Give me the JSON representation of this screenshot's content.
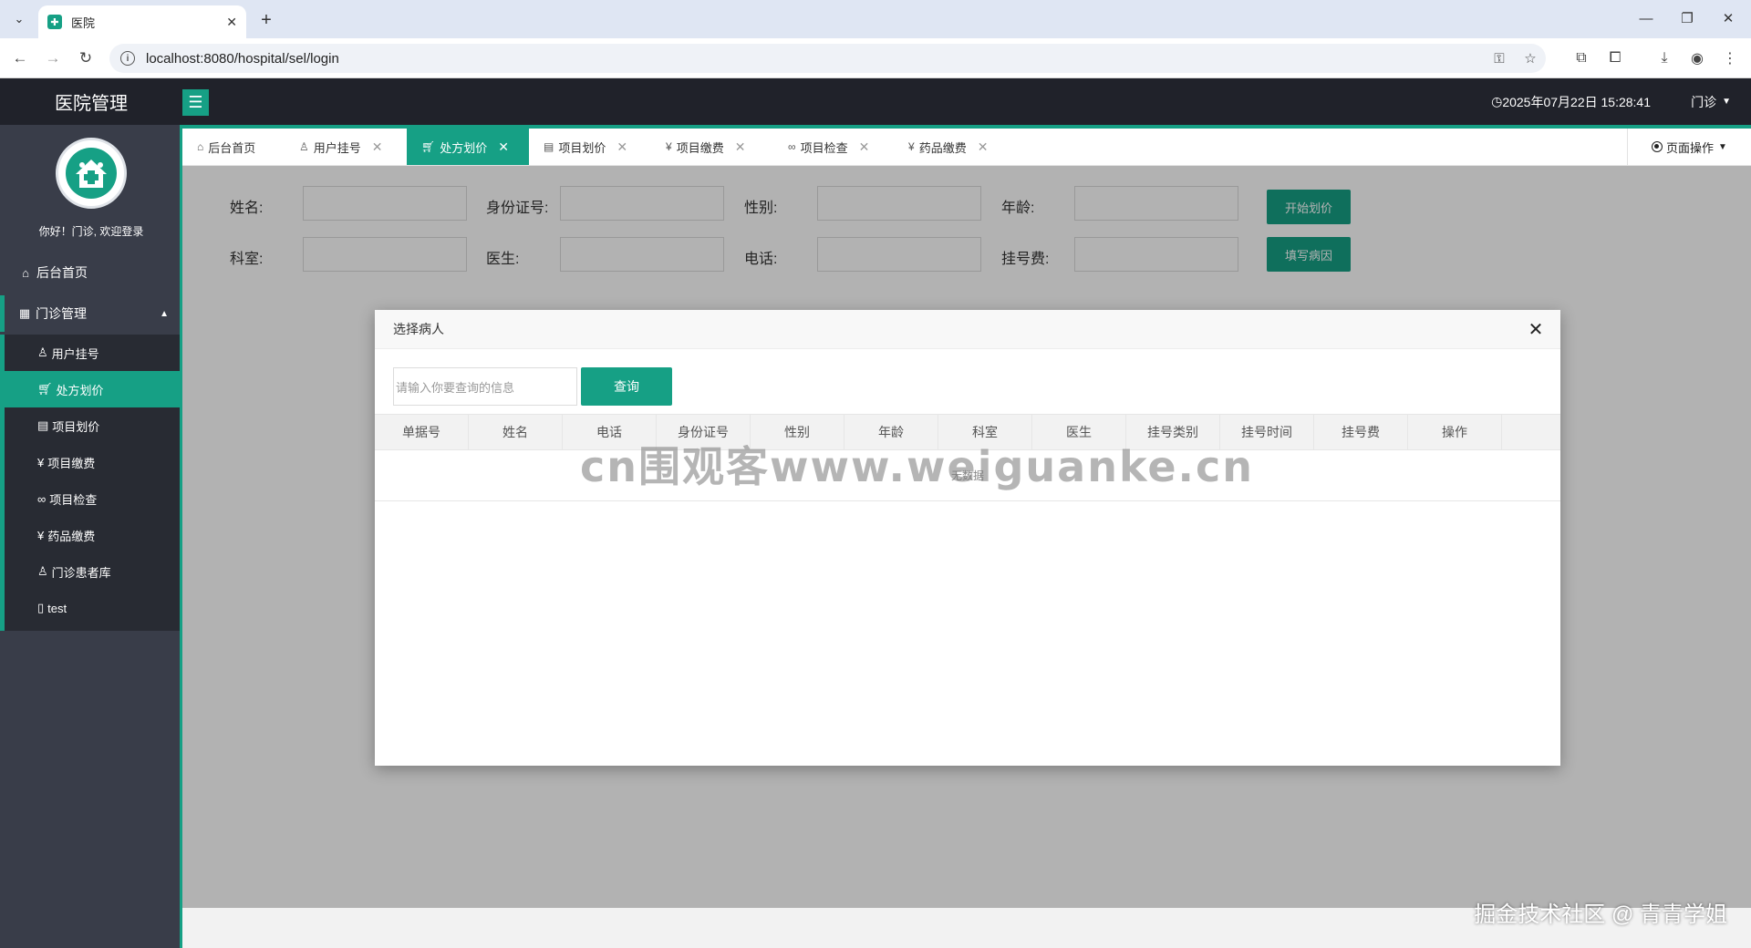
{
  "browser": {
    "tab_title": "医院",
    "url": "localhost:8080/hospital/sel/login"
  },
  "header": {
    "logo": "医院管理",
    "datetime": "2025年07月22日 15:28:41",
    "user": "门诊"
  },
  "sidebar": {
    "welcome": "你好！门诊, 欢迎登录",
    "home": "后台首页",
    "group": "门诊管理",
    "items": [
      {
        "label": "用户挂号",
        "icon": "user-icon"
      },
      {
        "label": "处方划价",
        "icon": "cart-icon"
      },
      {
        "label": "项目划价",
        "icon": "document-icon"
      },
      {
        "label": "项目缴费",
        "icon": "yen-icon"
      },
      {
        "label": "项目检查",
        "icon": "link-icon"
      },
      {
        "label": "药品缴费",
        "icon": "yen-icon"
      },
      {
        "label": "门诊患者库",
        "icon": "person-icon"
      },
      {
        "label": "test",
        "icon": "tablet-icon"
      }
    ]
  },
  "tabs": [
    {
      "label": "后台首页",
      "icon": "home-icon"
    },
    {
      "label": "用户挂号",
      "icon": "user-icon"
    },
    {
      "label": "处方划价",
      "icon": "cart-icon"
    },
    {
      "label": "项目划价",
      "icon": "document-icon"
    },
    {
      "label": "项目缴费",
      "icon": "yen-icon"
    },
    {
      "label": "项目检查",
      "icon": "link-icon"
    },
    {
      "label": "药品缴费",
      "icon": "yen-icon"
    }
  ],
  "page_ops": "页面操作",
  "form": {
    "name": "姓名:",
    "idcard": "身份证号:",
    "gender": "性别:",
    "age": "年龄:",
    "dept": "科室:",
    "doctor": "医生:",
    "phone": "电话:",
    "reg_fee": "挂号费:",
    "start_btn": "开始划价",
    "fill_btn": "填写病因"
  },
  "modal": {
    "title": "选择病人",
    "search_placeholder": "请输入你要查询的信息",
    "search_btn": "查询",
    "columns": [
      "单据号",
      "姓名",
      "电话",
      "身份证号",
      "性别",
      "年龄",
      "科室",
      "医生",
      "挂号类别",
      "挂号时间",
      "挂号费",
      "操作"
    ],
    "empty": "无数据"
  },
  "watermark": "cn围观客www.weiguanke.cn",
  "corner_mark": "掘金技术社区 @ 青青学姐",
  "colors": {
    "accent": "#16a085",
    "header": "#20222a",
    "sidebar": "#393d49"
  }
}
